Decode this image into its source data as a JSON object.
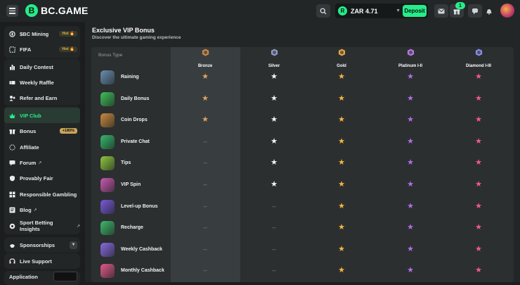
{
  "header": {
    "logo_mark": "B",
    "logo_text": "BC.GAME",
    "wallet_balance": "ZAR 4.71",
    "deposit_label": "Deposit",
    "gift_badge_count": "1"
  },
  "sidebar": {
    "group1": [
      {
        "label": "$BC Mining",
        "tag": "Hot",
        "icon": "bc-mining-icon"
      },
      {
        "label": "FIFA",
        "tag": "Hot",
        "icon": "fifa-icon"
      }
    ],
    "group2": [
      {
        "label": "Daily Contest",
        "icon": "daily-contest-icon"
      },
      {
        "label": "Weekly Raffle",
        "icon": "weekly-raffle-icon"
      },
      {
        "label": "Refer and Earn",
        "icon": "refer-earn-icon"
      }
    ],
    "group3": [
      {
        "label": "VIP Club",
        "icon": "vip-crown-icon",
        "active": true
      },
      {
        "label": "Bonus",
        "tag": "+180%",
        "icon": "bonus-icon"
      },
      {
        "label": "Affiliate",
        "icon": "affiliate-icon"
      },
      {
        "label": "Forum",
        "icon": "forum-icon",
        "external": true
      },
      {
        "label": "Provably Fair",
        "icon": "provably-fair-icon"
      },
      {
        "label": "Responsible Gambling",
        "icon": "responsible-gambling-icon"
      },
      {
        "label": "Blog",
        "icon": "blog-icon",
        "external": true
      },
      {
        "label": "Sport Betting Insights",
        "icon": "sport-insights-icon",
        "external": true
      }
    ],
    "sponsorships_label": "Sponsorships",
    "live_support_label": "Live Support",
    "application_label": "Application"
  },
  "main": {
    "title": "Exclusive VIP Bonus",
    "subtitle": "Discover the ultimate gaming experience",
    "column_header": "Bonus Type",
    "tiers": [
      {
        "name": "Bronze",
        "color": "#c98a4f"
      },
      {
        "name": "Silver",
        "color": "#8f9cc8"
      },
      {
        "name": "Gold",
        "color": "#e0a64a"
      },
      {
        "name": "Platinum I-II",
        "color": "#b57be0"
      },
      {
        "name": "Diamond I-III",
        "color": "#8a8fe8"
      }
    ],
    "star_colors": [
      "#e0a064",
      "#f4f4f4",
      "#f3b640",
      "#b06ee8",
      "#f25a8f"
    ],
    "rows": [
      {
        "name": "Raining",
        "icon_color": "#6a8fb0",
        "availability": [
          true,
          true,
          true,
          true,
          true
        ]
      },
      {
        "name": "Daily Bonus",
        "icon_color": "#3fbf5a",
        "availability": [
          true,
          true,
          true,
          true,
          true
        ]
      },
      {
        "name": "Coin Drops",
        "icon_color": "#c88a3f",
        "availability": [
          true,
          true,
          true,
          true,
          true
        ]
      },
      {
        "name": "Private Chat",
        "icon_color": "#35b86a",
        "availability": [
          false,
          true,
          true,
          true,
          true
        ]
      },
      {
        "name": "Tips",
        "icon_color": "#8fc83f",
        "availability": [
          false,
          true,
          true,
          true,
          true
        ]
      },
      {
        "name": "VIP Spin",
        "icon_color": "#c85ab0",
        "availability": [
          false,
          true,
          true,
          true,
          true
        ]
      },
      {
        "name": "Level-up Bonus",
        "icon_color": "#7a5ad8",
        "availability": [
          false,
          false,
          true,
          true,
          true
        ]
      },
      {
        "name": "Recharge",
        "icon_color": "#3fb86a",
        "availability": [
          false,
          false,
          true,
          true,
          true
        ]
      },
      {
        "name": "Weekly Cashback",
        "icon_color": "#8a6ae0",
        "availability": [
          false,
          false,
          true,
          true,
          true
        ]
      },
      {
        "name": "Monthly Cashback",
        "icon_color": "#e05a8a",
        "availability": [
          false,
          false,
          true,
          true,
          true
        ]
      }
    ],
    "star_glyph": "★",
    "dash_glyph": "--"
  }
}
